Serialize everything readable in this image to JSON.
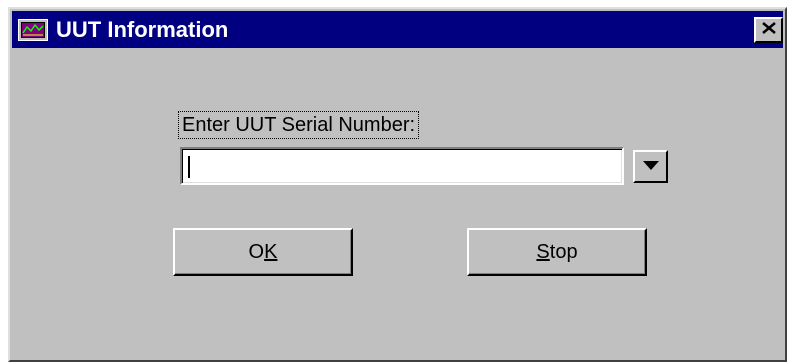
{
  "window": {
    "title": "UUT Information",
    "icon": "app-window-icon",
    "close_icon": "close-icon"
  },
  "form": {
    "serial_label": "Enter UUT Serial Number:",
    "serial_value": "",
    "dropdown_icon": "chevron-down-icon"
  },
  "buttons": {
    "ok": {
      "pre": "O",
      "mnemonic": "K",
      "post": ""
    },
    "stop": {
      "pre": "",
      "mnemonic": "S",
      "post": "top"
    }
  },
  "colors": {
    "titlebar": "#000080",
    "face": "#c0c0c0",
    "title_text": "#ffffff"
  }
}
